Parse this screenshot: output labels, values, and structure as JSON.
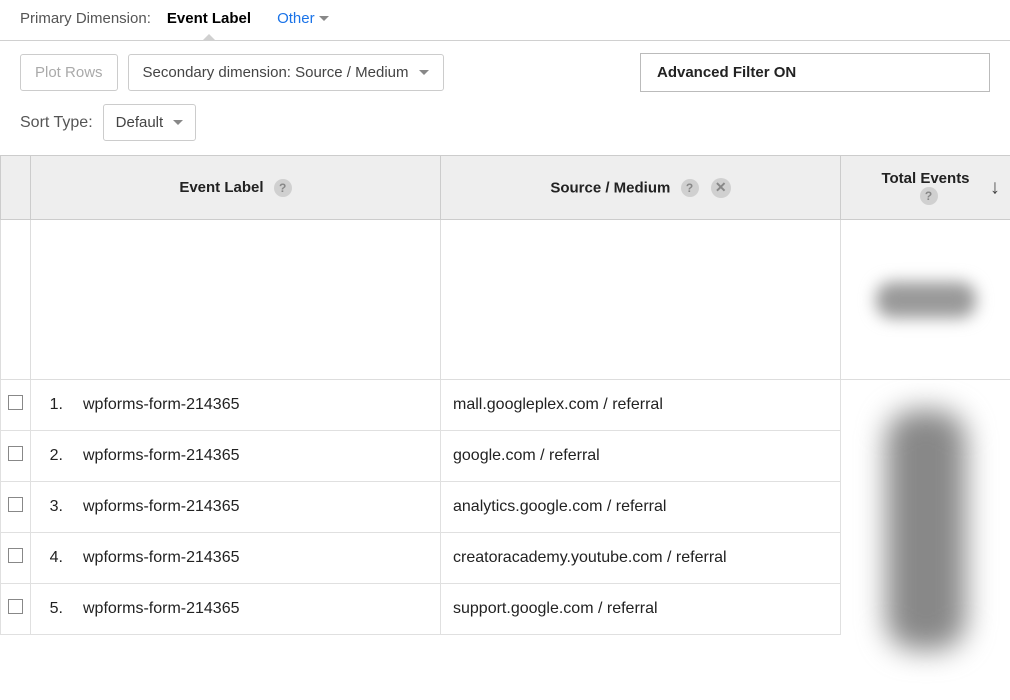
{
  "topBar": {
    "dimLabel": "Primary Dimension:",
    "dimActive": "Event Label",
    "otherLink": "Other"
  },
  "controls": {
    "plotRows": "Plot Rows",
    "secondaryDim": "Secondary dimension: Source / Medium",
    "advFilter": "Advanced Filter ON"
  },
  "sort": {
    "label": "Sort Type:",
    "value": "Default"
  },
  "headers": {
    "eventLabel": "Event Label",
    "sourceMedium": "Source / Medium",
    "totalEvents": "Total Events"
  },
  "rows": [
    {
      "num": "1.",
      "event": "wpforms-form-214365",
      "source": "mall.googleplex.com / referral"
    },
    {
      "num": "2.",
      "event": "wpforms-form-214365",
      "source": "google.com / referral"
    },
    {
      "num": "3.",
      "event": "wpforms-form-214365",
      "source": "analytics.google.com / referral"
    },
    {
      "num": "4.",
      "event": "wpforms-form-214365",
      "source": "creatoracademy.youtube.com / referral"
    },
    {
      "num": "5.",
      "event": "wpforms-form-214365",
      "source": "support.google.com / referral"
    }
  ]
}
